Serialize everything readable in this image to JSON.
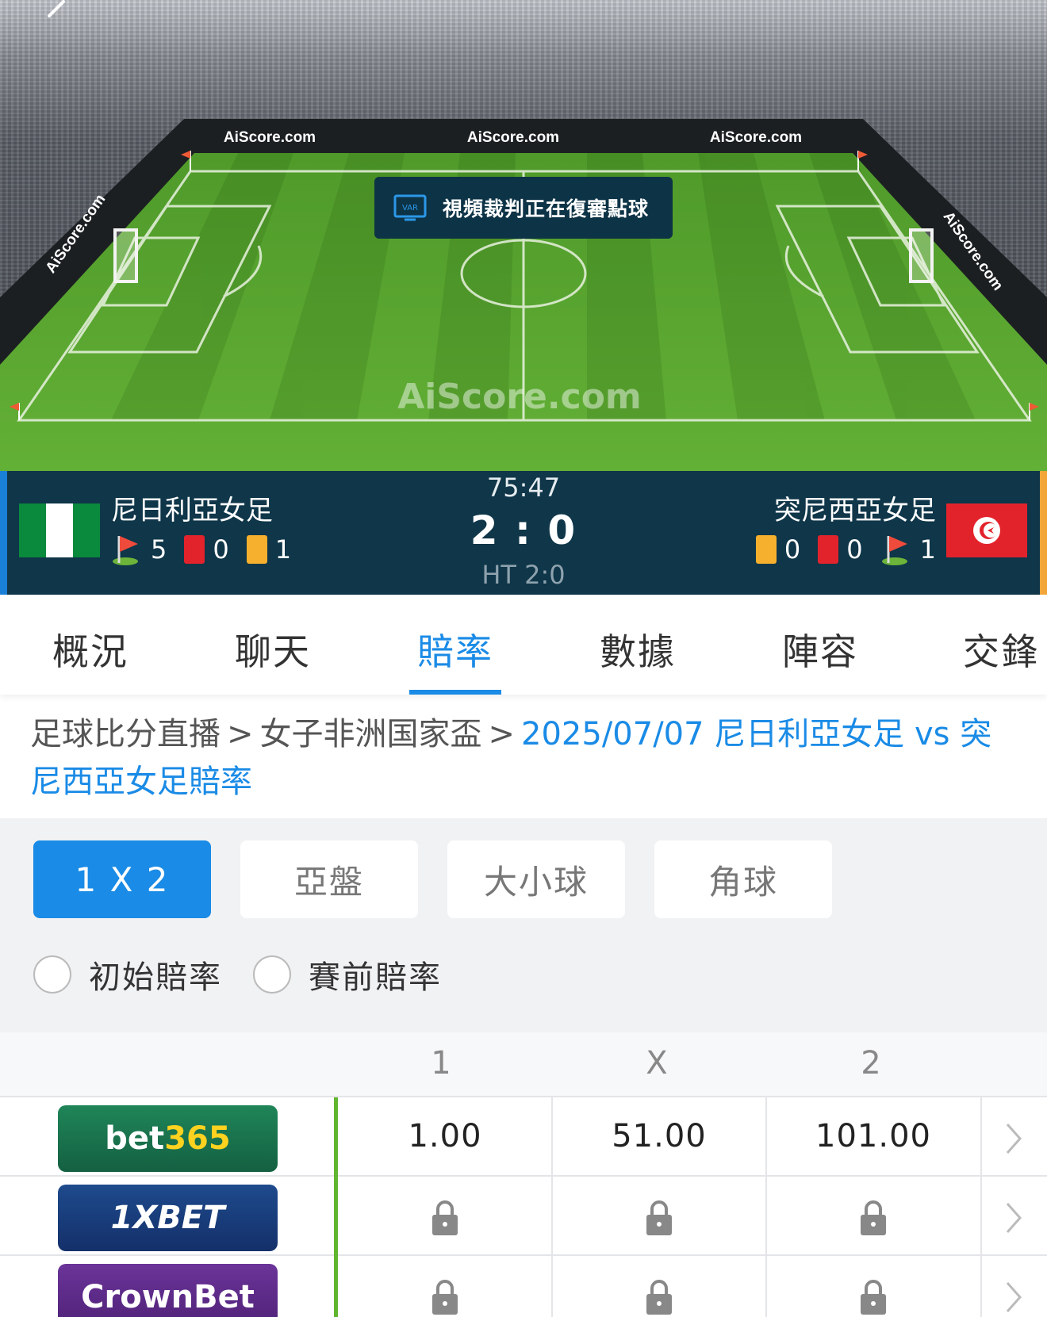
{
  "stadium": {
    "ad_board": "AiScore.com",
    "watermark": "AiScore.com",
    "var_banner": {
      "badge": "VAR",
      "text": "視頻裁判正在復審點球"
    }
  },
  "match": {
    "home": {
      "name": "尼日利亞女足",
      "corners": "5",
      "red_cards": "0",
      "yellow_cards": "1"
    },
    "away": {
      "name": "突尼西亞女足",
      "yellow_cards": "0",
      "red_cards": "0",
      "corners": "1"
    },
    "clock": "75:47",
    "score": "2 : 0",
    "half_time": "HT 2:0"
  },
  "tabs": [
    "概況",
    "聊天",
    "賠率",
    "數據",
    "陣容",
    "交鋒"
  ],
  "active_tab": "賠率",
  "breadcrumb": {
    "items": [
      "足球比分直播",
      "女子非洲国家盃"
    ],
    "current": "2025/07/07 尼日利亞女足 vs 突尼西亞女足賠率"
  },
  "markets": [
    "1 X 2",
    "亞盤",
    "大小球",
    "角球"
  ],
  "active_market": "1 X 2",
  "odds_options": [
    "初始賠率",
    "賽前賠率"
  ],
  "odds_table": {
    "columns": [
      "1",
      "X",
      "2"
    ],
    "rows": [
      {
        "bookmaker": "bet365",
        "odds": [
          "1.00",
          "51.00",
          "101.00"
        ]
      },
      {
        "bookmaker": "1XBET",
        "odds": [
          "locked",
          "locked",
          "locked"
        ]
      },
      {
        "bookmaker": "CrownBet",
        "odds": [
          "locked",
          "locked",
          "locked"
        ]
      }
    ]
  },
  "colors": {
    "accent": "#1a8be6",
    "scorebar": "#0f3649",
    "pitch": "#5aa532",
    "red_card": "#e3232c",
    "yellow_card": "#f7b02d",
    "bet365": "#1b7a4f",
    "1xbet": "#1c3f7a",
    "crownbet": "#5e2a86"
  },
  "icons": [
    "back-chevron-icon",
    "var-icon",
    "corner-flag-icon",
    "red-card-icon",
    "yellow-card-icon",
    "lock-icon",
    "chevron-right-icon"
  ]
}
